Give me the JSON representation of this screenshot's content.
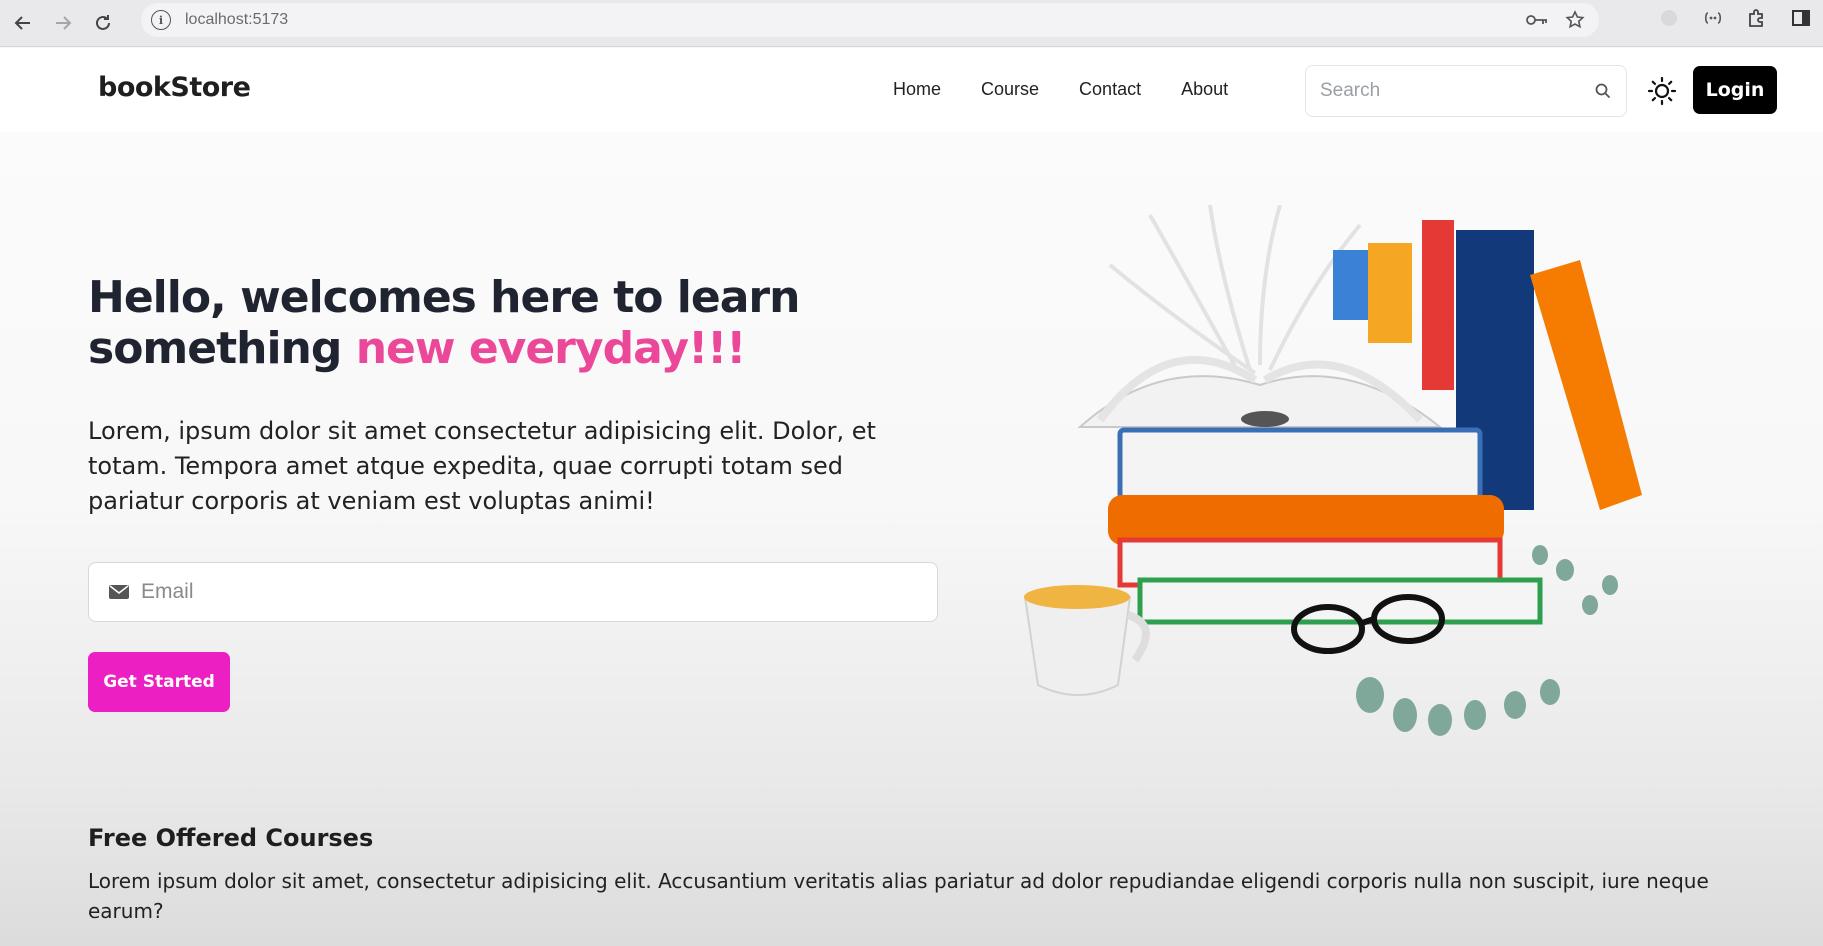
{
  "browser": {
    "url": "localhost:5173"
  },
  "navbar": {
    "logo": "bookStore",
    "links": [
      "Home",
      "Course",
      "Contact",
      "About"
    ],
    "search_placeholder": "Search",
    "login_label": "Login"
  },
  "hero": {
    "title_part1": "Hello, welcomes here to learn something ",
    "title_highlight": "new everyday!!!",
    "description": "Lorem, ipsum dolor sit amet consectetur adipisicing elit. Dolor, et totam. Tempora amet atque expedita, quae corrupti totam sed pariatur corporis at veniam est voluptas animi!",
    "email_placeholder": "Email",
    "cta_label": "Get Started"
  },
  "courses": {
    "title": "Free Offered Courses",
    "description": "Lorem ipsum dolor sit amet, consectetur adipisicing elit. Accusantium veritatis alias pariatur ad dolor repudiandae eligendi corporis nulla non suscipit, iure neque earum?"
  },
  "colors": {
    "accent_pink": "#ec4899",
    "cta_magenta": "#ec1fc3",
    "login_bg": "#000000"
  },
  "icons": [
    "back-arrow-icon",
    "forward-arrow-icon",
    "reload-icon",
    "site-info-icon",
    "password-key-icon",
    "bookmark-star-icon",
    "extension-icon",
    "puzzle-icon",
    "side-panel-icon",
    "search-icon",
    "sun-icon",
    "mail-icon"
  ]
}
